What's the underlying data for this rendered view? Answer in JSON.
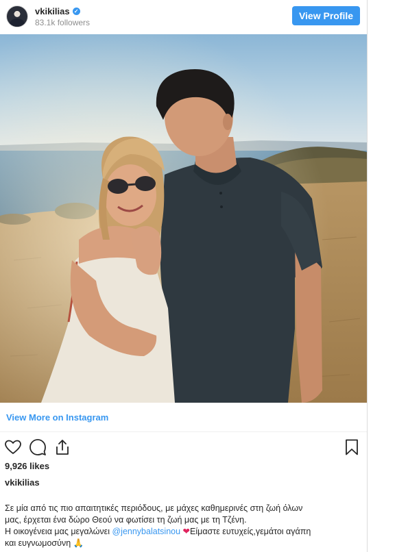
{
  "header": {
    "username": "vkikilias",
    "verified_mark": "✓",
    "followers": "83.1k followers",
    "view_profile_label": "View Profile"
  },
  "photo": {
    "icon": "photo-of-couple-on-seaside-hill"
  },
  "view_more_label": "View More on Instagram",
  "actions": {
    "like_icon": "heart-icon",
    "comment_icon": "comment-icon",
    "share_icon": "share-icon",
    "save_icon": "bookmark-icon"
  },
  "likes": "9,926 likes",
  "post_username": "vkikilias",
  "caption": {
    "line1": "Σε μία από τις πιο απαιτητικές περιόδους, με μάχες καθημερινές στη ζωή όλων",
    "line2": "μας, έρχεται ένα δώρο Θεού να φωτίσει τη ζωή μας με τη Τζένη.",
    "line3_prefix": "Η οικογένεια μας μεγαλώνει ",
    "mention": "@jennybalatsinou",
    "heart": "❤",
    "line3_suffix": "Είμαστε ευτυχείς,γεμάτοι αγάπη",
    "line4": "και ευγνωμοσύνη",
    "pray": "🙏"
  },
  "colors": {
    "accent": "#3897f0",
    "text": "#262626",
    "muted": "#8e8e8e"
  }
}
